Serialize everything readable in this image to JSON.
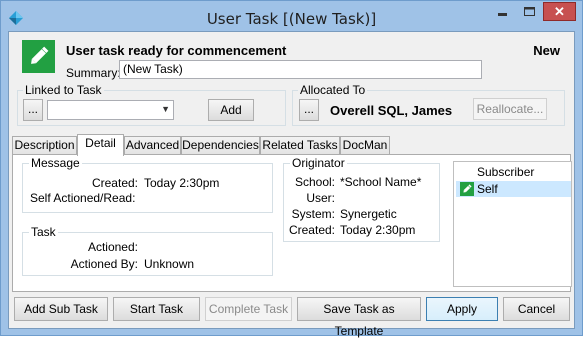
{
  "window": {
    "title": "User Task [(New Task)]",
    "close_glyph": "✕"
  },
  "header": {
    "heading": "User task ready for commencement",
    "status": "New",
    "summary_label": "Summary:",
    "summary_value": "(New Task)",
    "icon": "pencil-icon"
  },
  "linked": {
    "label": "Linked to Task",
    "browse_label": "...",
    "select_value": "",
    "add_label": "Add"
  },
  "allocated": {
    "label": "Allocated To",
    "browse_label": "...",
    "name": "Overell SQL, James",
    "reallocate_label": "Reallocate..."
  },
  "tabs": [
    {
      "label": "Description"
    },
    {
      "label": "Detail"
    },
    {
      "label": "Advanced"
    },
    {
      "label": "Dependencies"
    },
    {
      "label": "Related Tasks"
    },
    {
      "label": "DocMan"
    }
  ],
  "active_tab": "Detail",
  "message": {
    "label": "Message",
    "created_label": "Created:",
    "created_value": "Today 2:30pm",
    "self_label": "Self Actioned/Read:",
    "self_value": ""
  },
  "task": {
    "label": "Task",
    "actioned_label": "Actioned:",
    "actioned_value": "",
    "actioned_by_label": "Actioned By:",
    "actioned_by_value": "Unknown"
  },
  "originator": {
    "label": "Originator",
    "school_label": "School:",
    "school_value": "*School Name*",
    "user_label": "User:",
    "user_value": "",
    "system_label": "System:",
    "system_value": "Synergetic",
    "created_label": "Created:",
    "created_value": "Today 2:30pm"
  },
  "subscriber": {
    "header": "Subscriber",
    "items": [
      {
        "label": "Self",
        "icon": "pencil-icon"
      }
    ]
  },
  "footer": {
    "add_sub_task": "Add Sub Task",
    "start_task": "Start Task",
    "complete_task": "Complete Task",
    "save_template": "Save Task as Template",
    "apply": "Apply",
    "cancel": "Cancel"
  },
  "colors": {
    "titlebar": "#9fc2e7",
    "accent_green": "#22a042",
    "close_red": "#c75050",
    "selection": "#cce8ff"
  }
}
